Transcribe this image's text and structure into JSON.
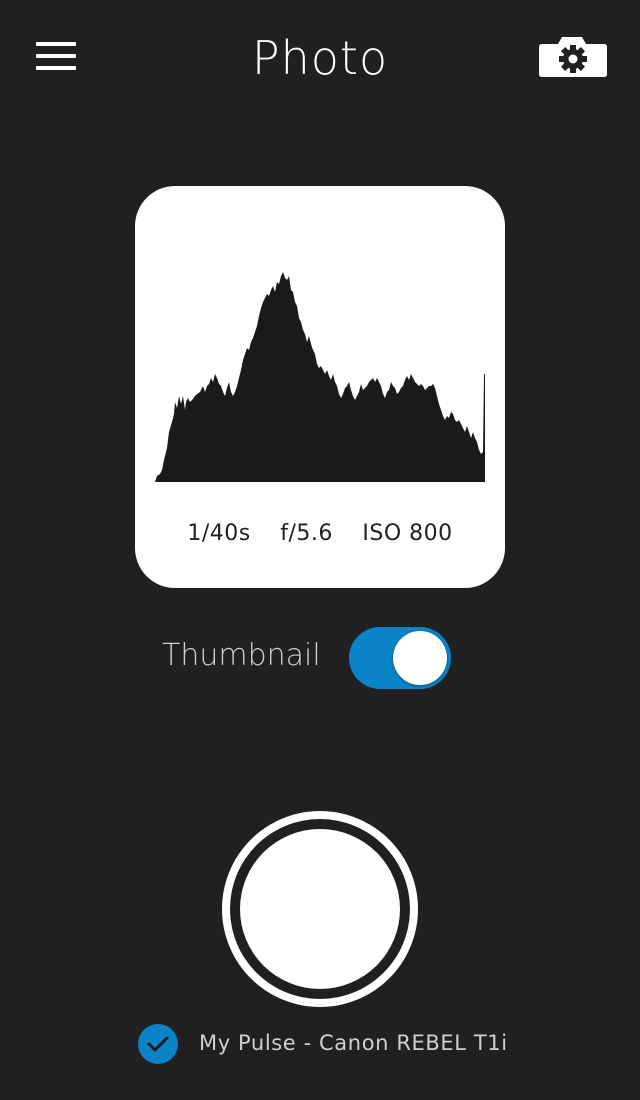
{
  "header": {
    "title": "Photo",
    "menu_icon": "hamburger-menu-icon",
    "settings_icon": "camera-settings-icon"
  },
  "histogram": {
    "shutter_speed": "1/40s",
    "aperture": "f/5.6",
    "iso": "ISO 800"
  },
  "thumbnail": {
    "label": "Thumbnail",
    "enabled": true
  },
  "shutter": {
    "icon": "shutter-icon"
  },
  "device": {
    "name": "My Pulse - Canon REBEL T1i",
    "selected": true
  },
  "colors": {
    "background": "#202020",
    "accent": "#0a84c6",
    "card": "#ffffff"
  }
}
